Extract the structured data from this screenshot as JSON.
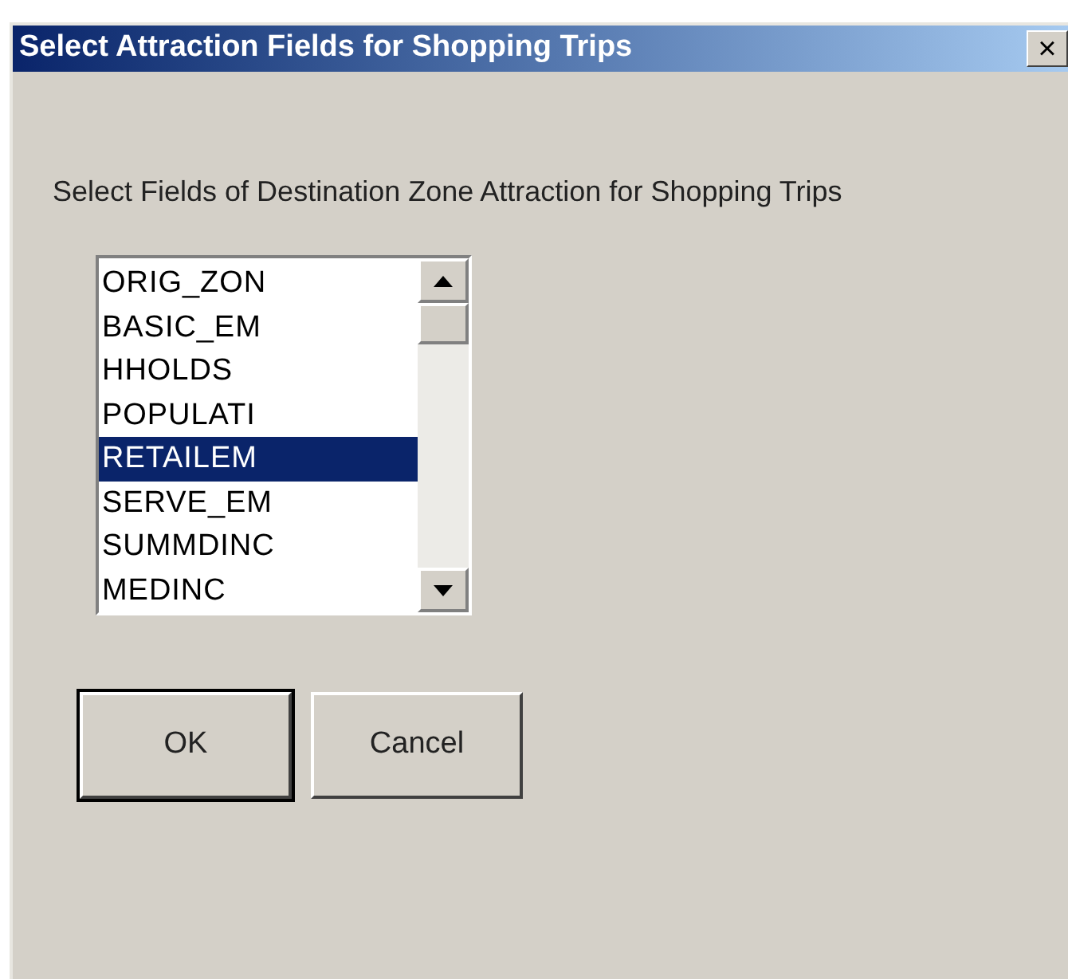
{
  "window": {
    "title": "Select Attraction Fields for Shopping Trips",
    "close": "×"
  },
  "prompt": "Select Fields of Destination Zone Attraction for Shopping Trips",
  "list": {
    "items": [
      {
        "label": "ORIG_ZON",
        "selected": false
      },
      {
        "label": "BASIC_EM",
        "selected": false
      },
      {
        "label": "HHOLDS",
        "selected": false
      },
      {
        "label": "POPULATI",
        "selected": false
      },
      {
        "label": "RETAILEM",
        "selected": true
      },
      {
        "label": "SERVE_EM",
        "selected": false
      },
      {
        "label": "SUMMDINC",
        "selected": false
      },
      {
        "label": "MEDINC",
        "selected": false
      }
    ]
  },
  "buttons": [
    {
      "label": "OK",
      "default": true
    },
    {
      "label": "Cancel",
      "default": false
    }
  ]
}
